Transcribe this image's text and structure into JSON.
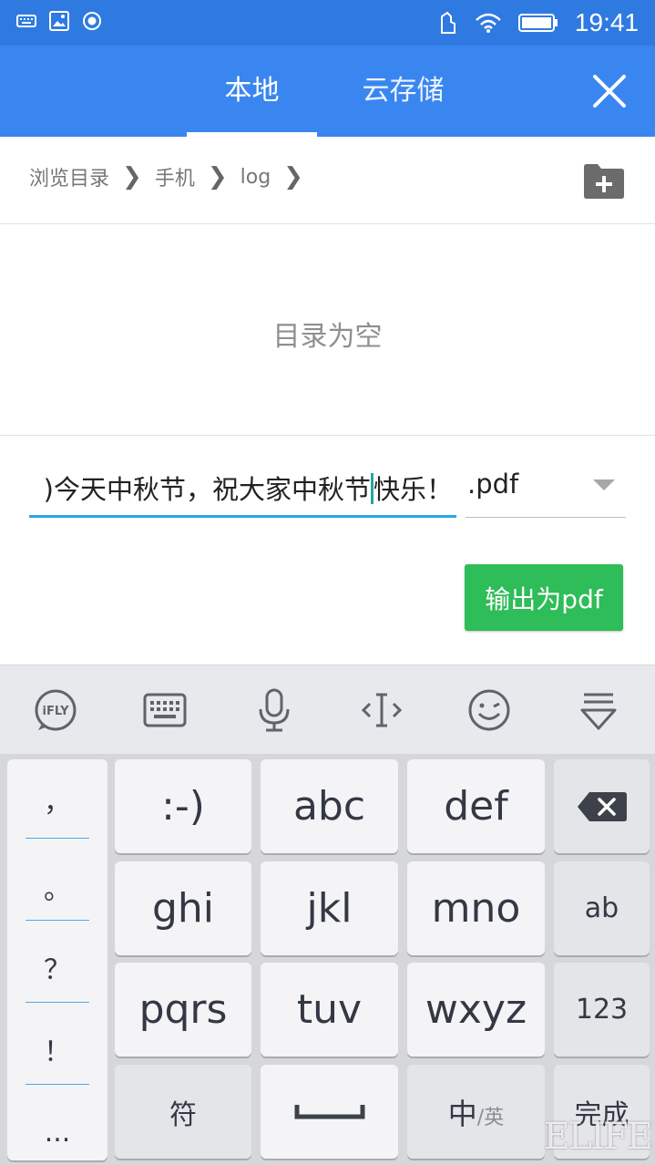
{
  "status_bar": {
    "time": "19:41",
    "icons_left": [
      "keyboard-icon",
      "image-icon",
      "record-icon"
    ],
    "icons_right": [
      "sync-icon",
      "wifi-icon",
      "battery-icon"
    ]
  },
  "app_bar": {
    "tabs": [
      {
        "label": "本地",
        "active": true
      },
      {
        "label": "云存储",
        "active": false
      }
    ],
    "close_icon": "close-icon",
    "accent": "#3a86f0"
  },
  "breadcrumb": {
    "items": [
      "浏览目录",
      "手机",
      "log"
    ],
    "separator": "❯",
    "new_folder_icon": "new-folder-icon"
  },
  "empty_state": {
    "text": "目录为空"
  },
  "filename": {
    "value_before_cursor": ")今天中秋节，祝大家中秋节",
    "value_after_cursor": "快乐！",
    "extension": ".pdf"
  },
  "export_button": {
    "label": "输出为pdf",
    "color": "#2ebd58"
  },
  "keyboard_toolbar": {
    "icons": [
      "ifly-icon",
      "keyboard-icon",
      "microphone-icon",
      "cursor-move-icon",
      "emoji-icon",
      "hide-keyboard-icon"
    ],
    "ifly_label": "iFLY"
  },
  "keyboard": {
    "punctuation": [
      "，",
      "。",
      "？",
      "！",
      "..."
    ],
    "rows": [
      [
        ":-)",
        "abc",
        "def"
      ],
      [
        "ghi",
        "jkl",
        "mno"
      ],
      [
        "pqrs",
        "tuv",
        "wxyz"
      ]
    ],
    "right_column": [
      "backspace",
      "ab",
      "123",
      "完成"
    ],
    "bottom": {
      "symbols": "符",
      "space": "space",
      "lang_main": "中",
      "lang_alt": "/英"
    }
  },
  "watermark": "ELIFE"
}
